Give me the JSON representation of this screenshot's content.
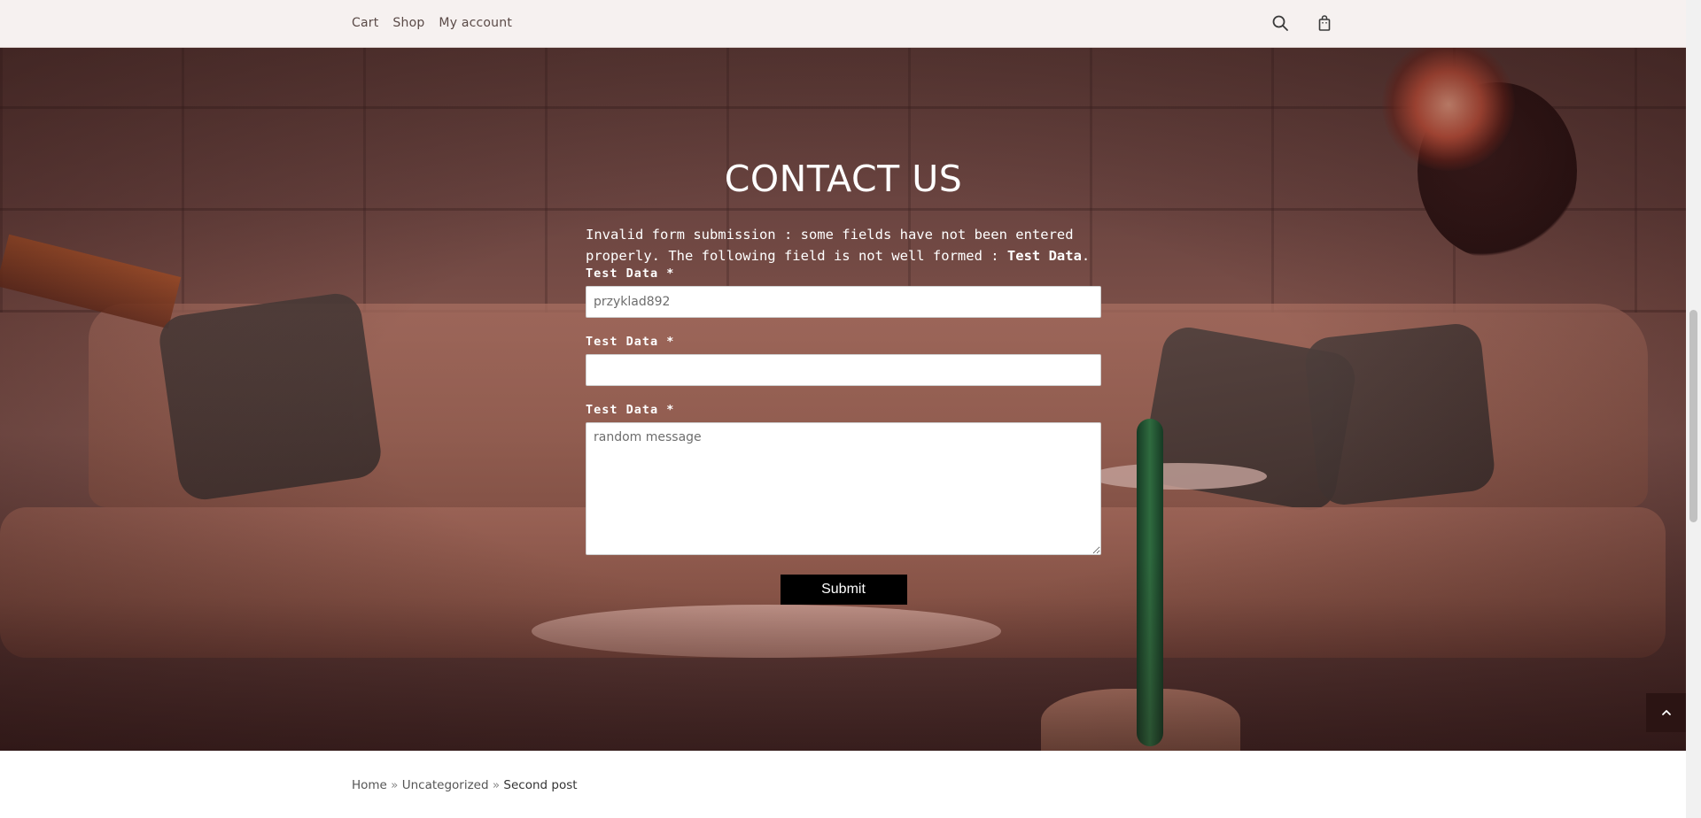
{
  "nav": {
    "items": [
      "Cart",
      "Shop",
      "My account"
    ],
    "search_icon": "search-icon",
    "cart_icon": "shopping-bag-icon"
  },
  "contact": {
    "title": "CONTACT US",
    "error_prefix": "Invalid form submission : some fields have not been entered properly. The following field is not well formed : ",
    "error_field": "Test Data",
    "error_suffix": ".",
    "fields": [
      {
        "label": "Test Data *",
        "value": "przyklad892"
      },
      {
        "label": "Test Data *",
        "value": ""
      },
      {
        "label": "Test Data *",
        "value": "random message"
      }
    ],
    "submit_label": "Submit"
  },
  "scroll_top_icon": "chevron-up-icon",
  "breadcrumb": {
    "home": "Home",
    "sep1": "»",
    "category": "Uncategorized",
    "sep2": "»",
    "current": "Second post"
  }
}
